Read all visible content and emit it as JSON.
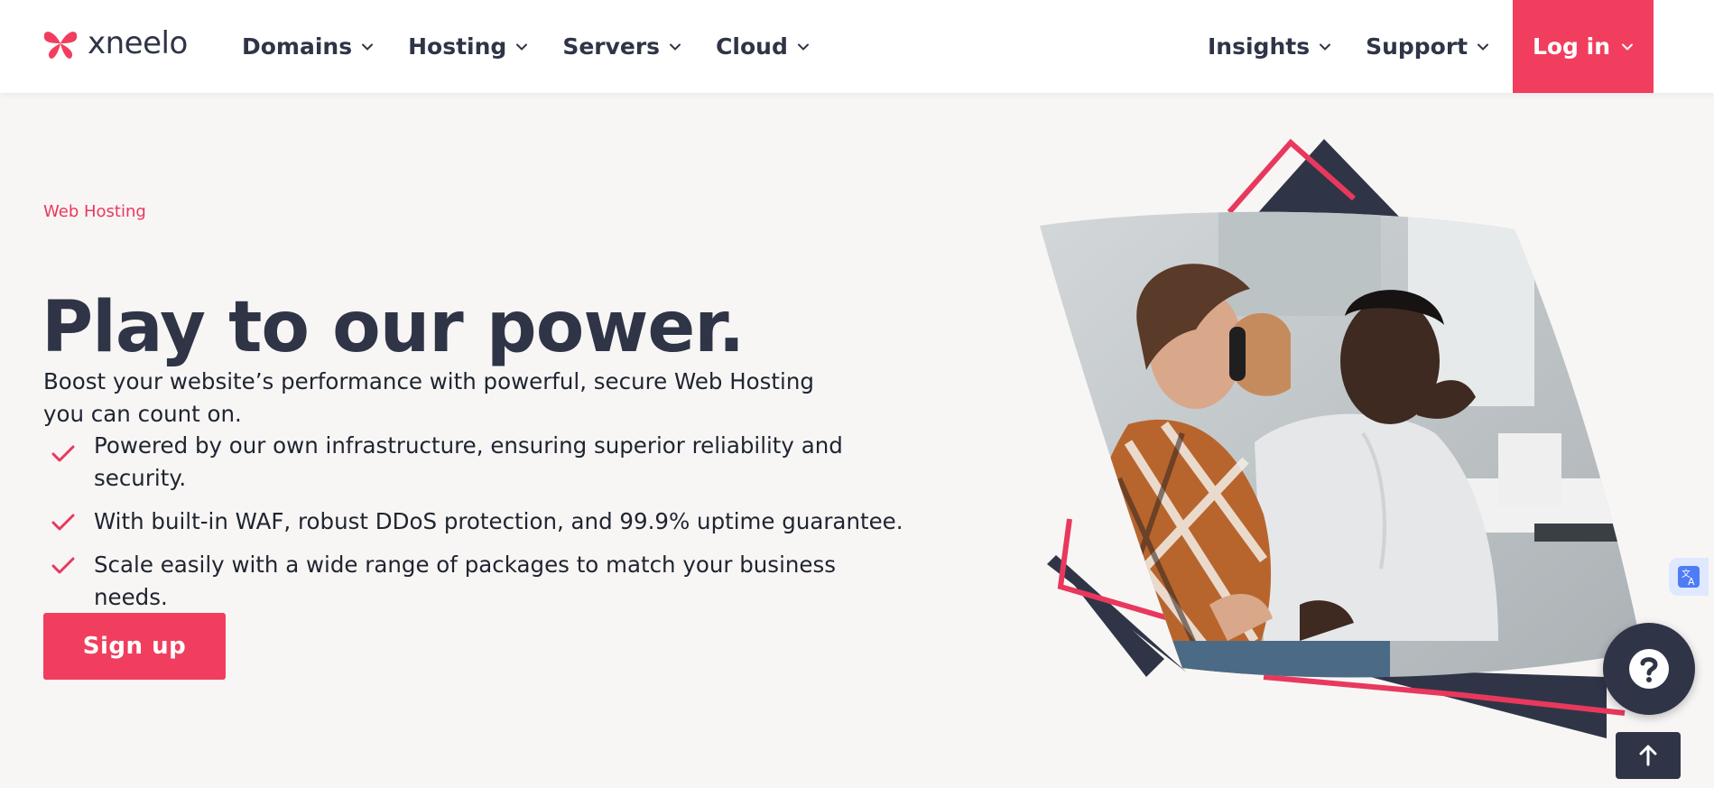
{
  "brand": {
    "name": "xneelo",
    "accent": "#f13e5e",
    "dark": "#2f3547",
    "background": "#f8f6f5"
  },
  "nav": {
    "left": [
      {
        "label": "Domains"
      },
      {
        "label": "Hosting"
      },
      {
        "label": "Servers"
      },
      {
        "label": "Cloud"
      }
    ],
    "right": [
      {
        "label": "Insights"
      },
      {
        "label": "Support"
      }
    ],
    "login": "Log in"
  },
  "hero": {
    "eyebrow": "Web Hosting",
    "headline": "Play to our power.",
    "subtitle": "Boost your website’s performance with powerful, secure Web Hosting you can count on.",
    "bullets": [
      "Powered by our own infrastructure, ensuring superior reliability and security.",
      "With built-in WAF, robust DDoS protection, and 99.9% uptime guarantee.",
      "Scale easily with a wide range of packages to match your business needs."
    ],
    "cta": "Sign up",
    "image": "two-men-talking-photo"
  },
  "widgets": {
    "translate": "translate-icon",
    "help": "question-mark-icon",
    "back_to_top": "arrow-up-icon"
  }
}
